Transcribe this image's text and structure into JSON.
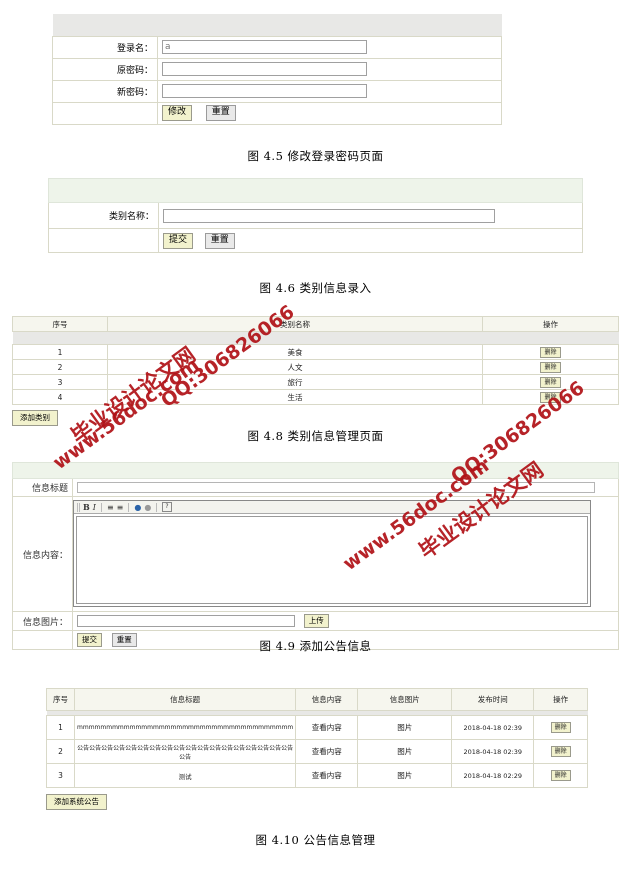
{
  "figures": [
    {
      "id": "fig-4-5",
      "caption": "图 4.5 修改登录密码页面",
      "form": {
        "fields": [
          {
            "label": "登录名：",
            "value": "a",
            "type": "text"
          },
          {
            "label": "原密码：",
            "value": "",
            "type": "password"
          },
          {
            "label": "新密码：",
            "value": "",
            "type": "password"
          }
        ],
        "buttons": [
          {
            "label": "修改",
            "style": "primary"
          },
          {
            "label": "重置",
            "style": "gray"
          }
        ]
      }
    },
    {
      "id": "fig-4-6",
      "caption": "图 4.6 类别信息录入",
      "form": {
        "fields": [
          {
            "label": "类别名称：",
            "value": "",
            "type": "text"
          }
        ],
        "buttons": [
          {
            "label": "提交",
            "style": "primary"
          },
          {
            "label": "重置",
            "style": "gray"
          }
        ]
      }
    },
    {
      "id": "fig-4-8",
      "caption": "图 4.8 类别信息管理页面",
      "table": {
        "columns": [
          "序号",
          "类别名称",
          "操作"
        ],
        "rows": [
          {
            "no": "1",
            "name": "美食",
            "action": "删除"
          },
          {
            "no": "2",
            "name": "人文",
            "action": "删除"
          },
          {
            "no": "3",
            "name": "旅行",
            "action": "删除"
          },
          {
            "no": "4",
            "name": "生活",
            "action": "删除"
          }
        ],
        "add_button": "添加类别"
      }
    },
    {
      "id": "fig-4-9",
      "caption": "图 4.9 添加公告信息",
      "form": {
        "title_label": "信息标题",
        "content_label": "信息内容：",
        "image_label": "信息图片：",
        "title_value": "",
        "image_value": "",
        "upload_button": "上传",
        "editor": {
          "tools": [
            {
              "name": "grip-handle",
              "glyph": ""
            },
            {
              "name": "bold-icon",
              "glyph": "B"
            },
            {
              "name": "italic-icon",
              "glyph": "I"
            },
            {
              "name": "ordered-list-icon",
              "glyph": "≡"
            },
            {
              "name": "unordered-list-icon",
              "glyph": "≡"
            },
            {
              "name": "link-icon",
              "glyph": "⚭"
            },
            {
              "name": "unlink-icon",
              "glyph": "⚭"
            },
            {
              "name": "help-icon",
              "glyph": "?"
            }
          ],
          "content": ""
        },
        "buttons": [
          {
            "label": "提交",
            "style": "primary"
          },
          {
            "label": "重置",
            "style": "gray"
          }
        ]
      }
    },
    {
      "id": "fig-4-10",
      "caption": "图 4.10 公告信息管理",
      "table": {
        "columns": [
          "序号",
          "信息标题",
          "信息内容",
          "信息图片",
          "发布时间",
          "操作"
        ],
        "rows": [
          {
            "no": "1",
            "title": "mmmmmmmmmmmmmmmmmmmmmmmmmmmmmmmmmmmmm",
            "content": "查看内容",
            "image": "图片",
            "time": "2018-04-18 02:39",
            "action": "删除"
          },
          {
            "no": "2",
            "title": "公告公告公告公告公告公告公告公告公告公告公告公告公告公告公告公告公告公告公告",
            "content": "查看内容",
            "image": "图片",
            "time": "2018-04-18 02:39",
            "action": "删除"
          },
          {
            "no": "3",
            "title": "测试",
            "content": "查看内容",
            "image": "图片",
            "time": "2018-04-18 02:29",
            "action": "删除"
          }
        ],
        "add_button": "添加系统公告"
      }
    }
  ],
  "watermarks": {
    "color": "#b01116",
    "items": [
      {
        "text": "毕业设计论文网"
      },
      {
        "text": "www.56doc.com"
      },
      {
        "text": "QQ:306826066"
      },
      {
        "text": "毕业设计论文网"
      },
      {
        "text": "www.56doc.com"
      },
      {
        "text": "QQ:306826066"
      }
    ]
  }
}
